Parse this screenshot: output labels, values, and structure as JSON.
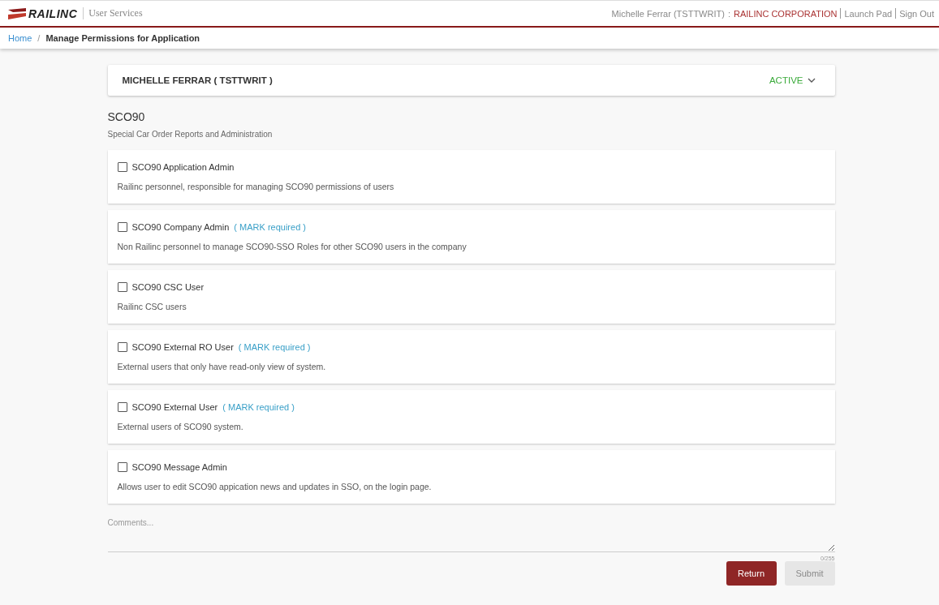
{
  "header": {
    "logo": "RAILINC",
    "app_title": "User Services",
    "user": "Michelle Ferrar  (TSTTWRIT)",
    "separator": ":",
    "company": "RAILINC CORPORATION",
    "links": [
      "Launch Pad",
      "Sign Out"
    ]
  },
  "breadcrumb": {
    "home": "Home",
    "separator": "/",
    "current": "Manage Permissions for Application"
  },
  "user_panel": {
    "name": "MICHELLE FERRAR ( TSTTWRIT )",
    "status": "ACTIVE",
    "expanded": false
  },
  "application": {
    "code": "SCO90",
    "description": "Special Car Order Reports and Administration"
  },
  "roles": [
    {
      "name": "SCO90 Application Admin",
      "description": "Railinc personnel, responsible for managing SCO90 permissions of users",
      "checked": false
    },
    {
      "name": "SCO90 Company Admin",
      "note": "( MARK required )",
      "description": "Non Railinc personnel to manage SCO90-SSO Roles for other SCO90 users in the company",
      "checked": false
    },
    {
      "name": "SCO90 CSC User",
      "description": "Railinc CSC users",
      "checked": false
    },
    {
      "name": "SCO90 External RO User",
      "note": "( MARK required )",
      "description": "External users that only have read-only view of system.",
      "checked": false
    },
    {
      "name": "SCO90 External User",
      "note": "( MARK required )",
      "description": "External users of SCO90 system.",
      "checked": false
    },
    {
      "name": "SCO90 Message Admin",
      "description": "Allows user to edit SCO90 appication news and updates in SSO, on the login page.",
      "checked": false
    }
  ],
  "comments": {
    "placeholder": "Comments...",
    "counter": "0/255"
  },
  "buttons": [
    {
      "label": "Return",
      "disabled": false
    },
    {
      "label": "Submit",
      "disabled": true
    }
  ]
}
